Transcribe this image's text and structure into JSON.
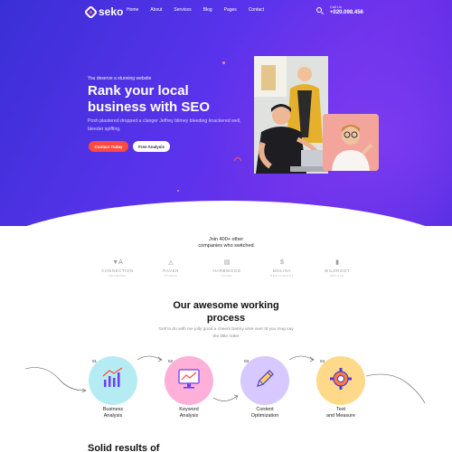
{
  "nav": {
    "logo": "seko",
    "links": [
      "Home",
      "About",
      "Services",
      "Blog",
      "Pages",
      "Contact"
    ],
    "call_label": "Call Us",
    "phone": "+020.098.456"
  },
  "hero": {
    "eyebrow": "You deserve a stunning website",
    "headline_line1": "Rank your local",
    "headline_line2": "business with SEO",
    "subtext": "Posh plastered dropped a clanger Jeffrey blimey bleeding knackered well, bleeder spiffing.",
    "primary_button": "Contact Today",
    "secondary_button": "Free Analysis"
  },
  "trust": {
    "line1": "Join 400+ other",
    "line2": "companies who switched",
    "brands": [
      {
        "mark": "▼A",
        "name": "CONNECTION",
        "tag": "NETWORK"
      },
      {
        "mark": "◬",
        "name": "RAVEN",
        "tag": "STUDIO"
      },
      {
        "mark": "▤",
        "name": "HARBWOOD",
        "tag": "HOTEL"
      },
      {
        "mark": "$",
        "name": "MOLINA",
        "tag": "RESTAURANT"
      },
      {
        "mark": "▮",
        "name": "WILDROOT",
        "tag": "ESTATE"
      }
    ]
  },
  "process": {
    "title_line1": "Our awesome working",
    "title_line2": "process",
    "subtitle": "Gell to do with me jolly good a cheers barmy arse over tit you mug say the little rotter",
    "steps": [
      {
        "num": "01",
        "line1": "Business",
        "line2": "Analysis",
        "color": "#b5ecf3",
        "icon": "bar-chart-icon"
      },
      {
        "num": "02",
        "line1": "Keyword",
        "line2": "Analysis",
        "color": "#ffb0d9",
        "icon": "monitor-chart-icon"
      },
      {
        "num": "03",
        "line1": "Content",
        "line2": "Optimization",
        "color": "#d7c9ff",
        "icon": "pencil-icon"
      },
      {
        "num": "04",
        "line1": "Test",
        "line2": "and Measure",
        "color": "#ffd98a",
        "icon": "gear-icon"
      }
    ]
  },
  "bottom": {
    "title": "Solid results of"
  },
  "colors": {
    "hero_start": "#3a2fd6",
    "hero_end": "#6b2fe9",
    "accent": "#ff4a3d"
  }
}
